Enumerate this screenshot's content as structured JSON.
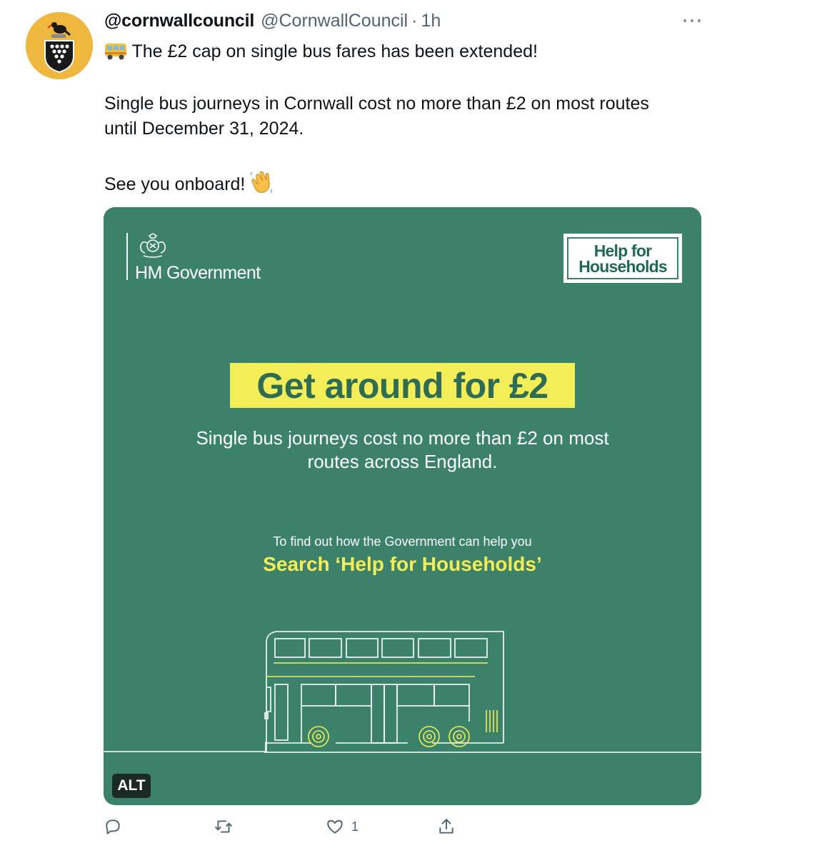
{
  "tweet": {
    "display_name": "@cornwallcouncil",
    "handle": "@CornwallCouncil",
    "separator": "·",
    "time": "1h",
    "line1": "The £2 cap on single bus fares has been extended!",
    "line2": "Single bus journeys in Cornwall cost no more than £2 on most routes",
    "line3": "until December 31, 2024.",
    "line4": "See you onboard!",
    "icons": {
      "bus_emoji": "bus-emoji",
      "wave_emoji": "waving-hand-emoji",
      "more": "more-icon"
    }
  },
  "media": {
    "gov_label": "HM Government",
    "hfh_line1": "Help for",
    "hfh_line2": "Households",
    "headline": "Get around for £2",
    "sub_line1": "Single bus journeys cost no more than £2 on most",
    "sub_line2": "routes across England.",
    "find_text": "To find out how the Government can help you",
    "search_text": "Search ‘Help for Households’",
    "alt_label": "ALT",
    "colors": {
      "background": "#3c826a",
      "accent": "#f3ee58",
      "text": "#ffffff"
    }
  },
  "actions": {
    "reply_icon": "reply-icon",
    "retweet_icon": "retweet-icon",
    "like_icon": "heart-icon",
    "like_count": "1",
    "share_icon": "share-icon"
  }
}
